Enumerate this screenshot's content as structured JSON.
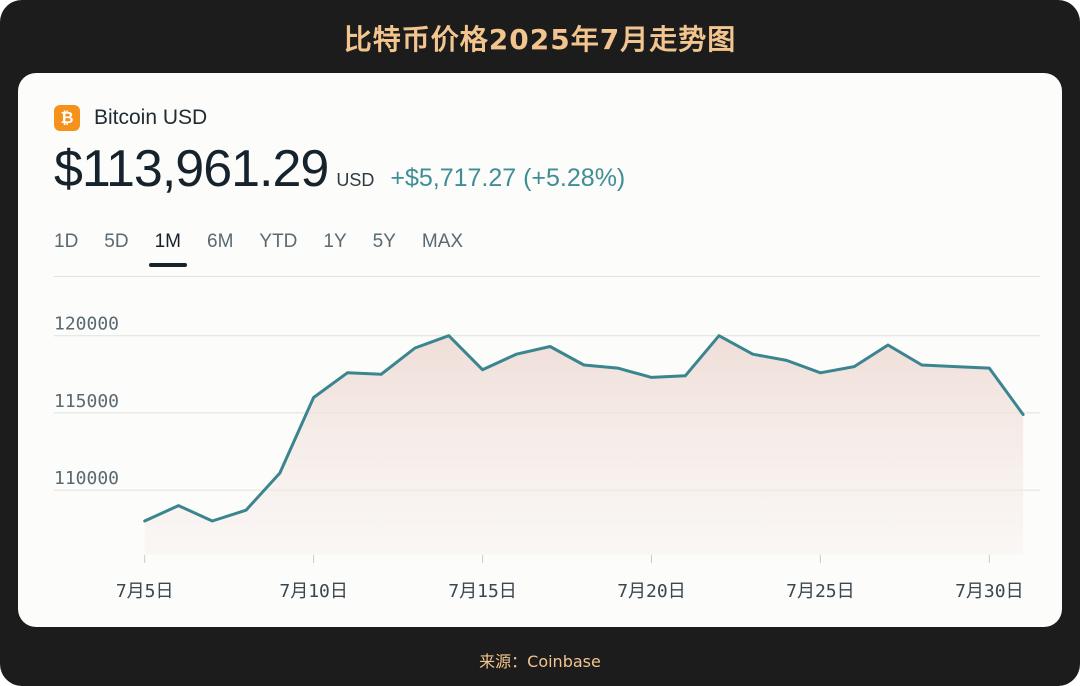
{
  "header": {
    "title": "比特币价格2025年7月走势图"
  },
  "asset": {
    "icon": "bitcoin-icon",
    "icon_glyph": "₿",
    "name": "Bitcoin USD",
    "price": "$113,961.29",
    "currency": "USD",
    "change": "+$5,717.27 (+5.28%)"
  },
  "tabs": [
    {
      "label": "1D"
    },
    {
      "label": "5D"
    },
    {
      "label": "1M",
      "active": true
    },
    {
      "label": "6M"
    },
    {
      "label": "YTD"
    },
    {
      "label": "1Y"
    },
    {
      "label": "5Y"
    },
    {
      "label": "MAX"
    }
  ],
  "footer": {
    "source": "来源：Coinbase"
  },
  "colors": {
    "line": "#3a858f",
    "fill_top": "#efdcd6",
    "accent_title": "#f2c48e",
    "coin": "#f5921b"
  },
  "chart_data": {
    "type": "area",
    "x": [
      5,
      6,
      7,
      8,
      9,
      10,
      11,
      12,
      13,
      14,
      15,
      16,
      17,
      18,
      19,
      20,
      21,
      22,
      23,
      24,
      25,
      26,
      27,
      28,
      29,
      30,
      31
    ],
    "values": [
      108000,
      109000,
      108000,
      108700,
      111100,
      116000,
      117600,
      117500,
      119200,
      120000,
      117800,
      118800,
      119300,
      118100,
      117900,
      117300,
      117400,
      120000,
      118800,
      118400,
      117600,
      118000,
      119400,
      118100,
      118000,
      117900,
      114900
    ],
    "ylim": [
      105800,
      123800
    ],
    "yticks": [
      110000,
      115000,
      120000
    ],
    "xticks": [
      5,
      10,
      15,
      20,
      25,
      30
    ],
    "xtick_labels": [
      "7月5日",
      "7月10日",
      "7月15日",
      "7月20日",
      "7月25日",
      "7月30日"
    ],
    "xlabel": "",
    "ylabel": "",
    "grid": true
  }
}
